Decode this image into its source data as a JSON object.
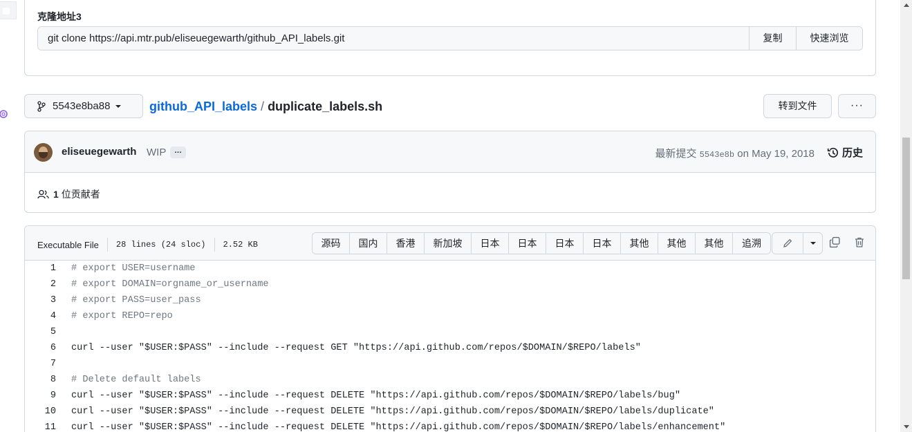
{
  "clone": {
    "title": "克隆地址3",
    "url": "git clone https://api.mtr.pub/eliseuegewarth/github_API_labels.git",
    "copy_label": "复制",
    "browse_label": "快速浏览"
  },
  "nav": {
    "branch": "5543e8ba88",
    "repo": "github_API_labels",
    "separator": "/",
    "file": "duplicate_labels.sh",
    "goto_label": "转到文件",
    "more_label": "···"
  },
  "commit": {
    "author": "eliseuegewarth",
    "message": "WIP",
    "ellipsis": "…",
    "latest_prefix": "最新提交",
    "sha": "5543e8b",
    "date": "on May 19, 2018",
    "history_label": "历史",
    "contributors_count": "1",
    "contributors_label": "位贡献者"
  },
  "file": {
    "type": "Executable File",
    "lines": "28 lines (24 sloc)",
    "size": "2.52 KB",
    "mirrors": [
      "源码",
      "国内",
      "香港",
      "新加坡",
      "日本",
      "日本",
      "日本",
      "日本",
      "其他",
      "其他",
      "其他",
      "追溯"
    ]
  },
  "code": [
    {
      "n": "1",
      "text": "# export USER=username",
      "comment": true
    },
    {
      "n": "2",
      "text": "# export DOMAIN=orgname_or_username",
      "comment": true
    },
    {
      "n": "3",
      "text": "# export PASS=user_pass",
      "comment": true
    },
    {
      "n": "4",
      "text": "# export REPO=repo",
      "comment": true
    },
    {
      "n": "5",
      "text": "",
      "comment": false
    },
    {
      "n": "6",
      "text": "curl --user \"$USER:$PASS\" --include --request GET \"https://api.github.com/repos/$DOMAIN/$REPO/labels\"",
      "comment": false
    },
    {
      "n": "7",
      "text": "",
      "comment": false
    },
    {
      "n": "8",
      "text": "# Delete default labels",
      "comment": true
    },
    {
      "n": "9",
      "text": "curl --user \"$USER:$PASS\" --include --request DELETE \"https://api.github.com/repos/$DOMAIN/$REPO/labels/bug\"",
      "comment": false
    },
    {
      "n": "10",
      "text": "curl --user \"$USER:$PASS\" --include --request DELETE \"https://api.github.com/repos/$DOMAIN/$REPO/labels/duplicate\"",
      "comment": false
    },
    {
      "n": "11",
      "text": "curl --user \"$USER:$PASS\" --include --request DELETE \"https://api.github.com/repos/$DOMAIN/$REPO/labels/enhancement\"",
      "comment": false
    }
  ],
  "colors": {
    "link": "#0969da",
    "border": "#d0d7de",
    "header_bg": "#f6f8fa",
    "comment": "#6e7781"
  }
}
